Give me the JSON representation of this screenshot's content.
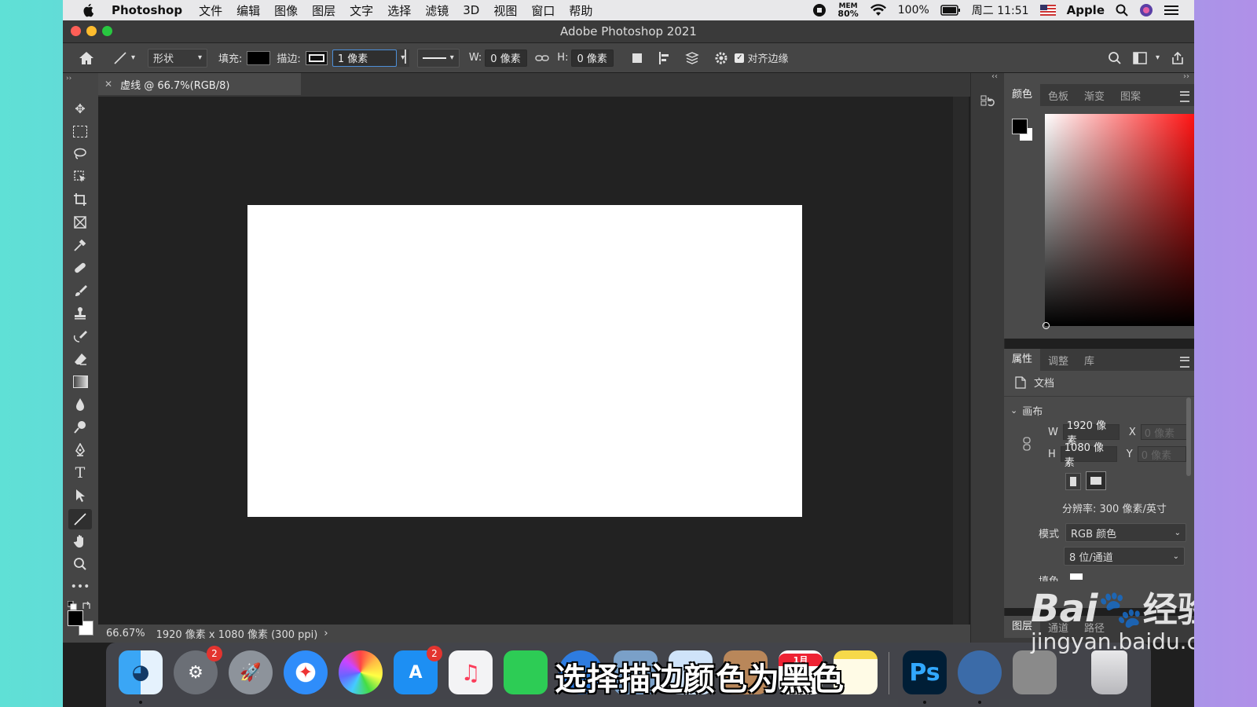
{
  "menubar": {
    "app_name": "Photoshop",
    "items": [
      "文件",
      "编辑",
      "图像",
      "图层",
      "文字",
      "选择",
      "滤镜",
      "3D",
      "视图",
      "窗口",
      "帮助"
    ],
    "mem_label": "MEM",
    "mem_value": "80%",
    "battery": "100%",
    "clock": "周二 11:51",
    "user": "Apple"
  },
  "window": {
    "title": "Adobe Photoshop 2021"
  },
  "options": {
    "mode": "形状",
    "fill_label": "填充:",
    "stroke_label": "描边:",
    "stroke_width": "1 像素",
    "w_label": "W:",
    "w_value": "0 像素",
    "h_label": "H:",
    "h_value": "0 像素",
    "align_edges": "对齐边缘"
  },
  "document": {
    "tab_title": "虚线 @ 66.7%(RGB/8)",
    "zoom": "66.67%",
    "info": "1920 像素 x 1080 像素 (300 ppi)"
  },
  "color_panel": {
    "tabs": [
      "颜色",
      "色板",
      "渐变",
      "图案"
    ]
  },
  "properties_panel": {
    "tabs": [
      "属性",
      "调整",
      "库"
    ],
    "doc_label": "文档",
    "section": "画布",
    "w_label": "W",
    "w_value": "1920 像素",
    "x_label": "X",
    "x_placeholder": "0 像素",
    "h_label": "H",
    "h_value": "1080 像素",
    "y_label": "Y",
    "y_placeholder": "0 像素",
    "resolution": "分辨率: 300 像素/英寸",
    "mode_label": "模式",
    "mode_value": "RGB 颜色",
    "depth_value": "8 位/通道",
    "partial_label": "填色"
  },
  "layers_panel": {
    "tabs": [
      "图层",
      "通道",
      "路径"
    ]
  },
  "dock": {
    "badges": {
      "system_prefs": "2",
      "app_store": "2"
    },
    "calendar_month": "1月",
    "calendar_day": "4",
    "ps_label": "Ps"
  },
  "subtitle": "选择描边颜色为黑色",
  "watermark": {
    "brand": "Bai",
    "brand2": "经验",
    "url": "jingyan.baidu.com"
  }
}
